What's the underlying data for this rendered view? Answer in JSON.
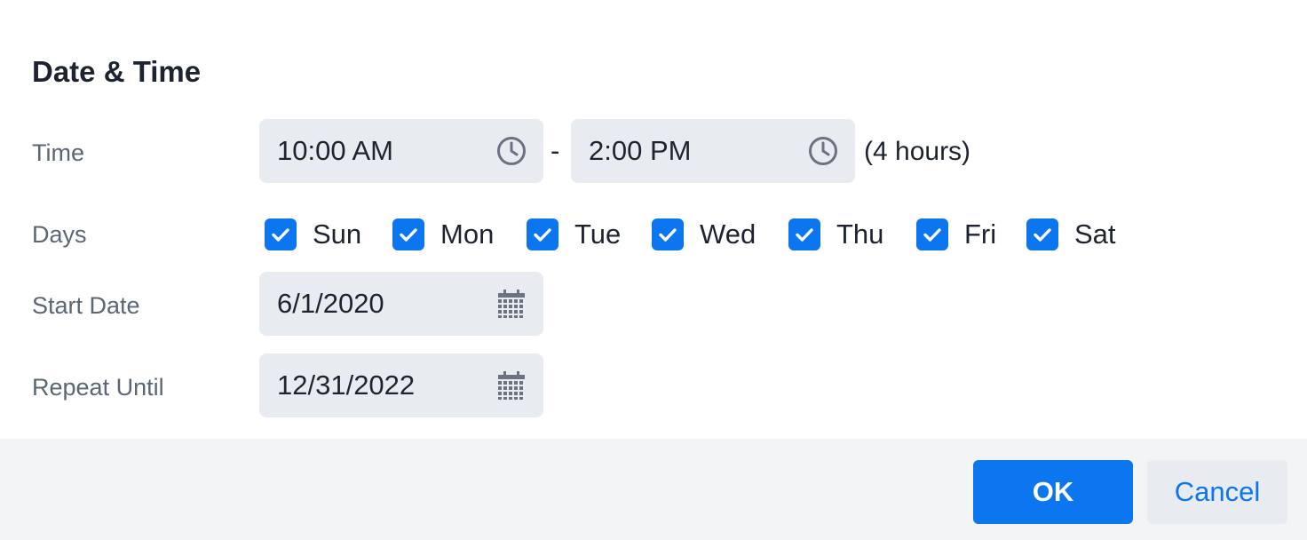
{
  "dialog": {
    "title": "Date & Time"
  },
  "time": {
    "label": "Time",
    "start": "10:00 AM",
    "separator": "-",
    "end": "2:00 PM",
    "duration": "(4 hours)",
    "icon": "clock-icon"
  },
  "days": {
    "label": "Days",
    "items": [
      {
        "label": "Sun",
        "checked": true
      },
      {
        "label": "Mon",
        "checked": true
      },
      {
        "label": "Tue",
        "checked": true
      },
      {
        "label": "Wed",
        "checked": true
      },
      {
        "label": "Thu",
        "checked": true
      },
      {
        "label": "Fri",
        "checked": true
      },
      {
        "label": "Sat",
        "checked": true
      }
    ]
  },
  "start_date": {
    "label": "Start Date",
    "value": "6/1/2020",
    "icon": "calendar-icon"
  },
  "repeat_until": {
    "label": "Repeat Until",
    "value": "12/31/2022",
    "icon": "calendar-icon"
  },
  "footer": {
    "ok_label": "OK",
    "cancel_label": "Cancel"
  },
  "colors": {
    "accent": "#0b76f0",
    "field_bg": "#e8ebf0",
    "footer_bg": "#f3f4f6",
    "label": "#5b6678",
    "text": "#1e2330"
  }
}
